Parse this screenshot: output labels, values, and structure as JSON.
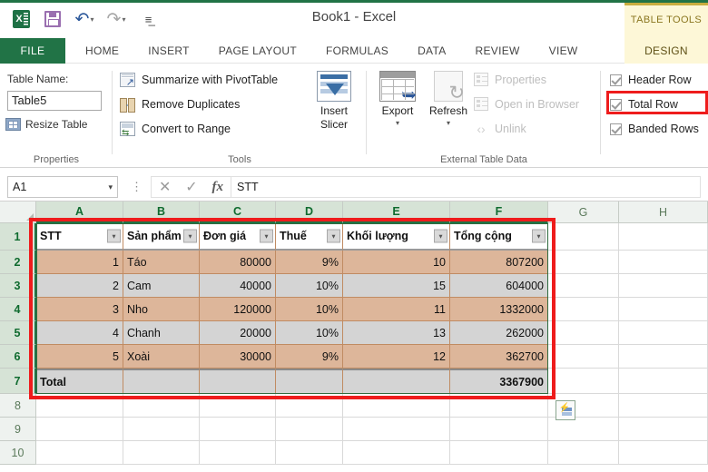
{
  "titlebar": {
    "app_title": "Book1 - Excel",
    "context_tab_group": "TABLE TOOLS",
    "qat": [
      {
        "name": "excel-logo-icon",
        "label": "X"
      },
      {
        "name": "save-icon",
        "label": "Save"
      },
      {
        "name": "undo-icon",
        "label": "Undo"
      },
      {
        "name": "redo-icon",
        "label": "Redo"
      },
      {
        "name": "customize-qat-icon",
        "label": "Customize Quick Access Toolbar"
      }
    ]
  },
  "ribbon_tabs": {
    "file": "FILE",
    "items": [
      "HOME",
      "INSERT",
      "PAGE LAYOUT",
      "FORMULAS",
      "DATA",
      "REVIEW",
      "VIEW"
    ],
    "design": "DESIGN",
    "active": "DESIGN"
  },
  "ribbon": {
    "properties": {
      "group_title": "Properties",
      "table_name_label": "Table Name:",
      "table_name_value": "Table5",
      "resize_table": "Resize Table"
    },
    "tools": {
      "group_title": "Tools",
      "summarize": "Summarize with PivotTable",
      "remove_duplicates": "Remove Duplicates",
      "convert_to_range": "Convert to Range",
      "insert_slicer_line1": "Insert",
      "insert_slicer_line2": "Slicer"
    },
    "external_data": {
      "group_title": "External Table Data",
      "export": "Export",
      "refresh": "Refresh",
      "properties": "Properties",
      "open_in_browser": "Open in Browser",
      "unlink": "Unlink",
      "dropdown_caret": "▾"
    },
    "style_options": {
      "header_row": {
        "label": "Header Row",
        "checked": true
      },
      "total_row": {
        "label": "Total Row",
        "checked": true,
        "highlighted": true
      },
      "banded_rows": {
        "label": "Banded Rows",
        "checked": true
      }
    }
  },
  "formula_bar": {
    "name_box_value": "A1",
    "name_box_caret": "▾",
    "cancel_icon": "✕",
    "enter_icon": "✓",
    "fx_icon": "fx",
    "formula_value": "STT"
  },
  "grid": {
    "column_headers": [
      "A",
      "B",
      "C",
      "D",
      "E",
      "F",
      "G",
      "H"
    ],
    "selected_columns": [
      "A",
      "B",
      "C",
      "D",
      "E",
      "F"
    ],
    "row_headers": [
      "1",
      "2",
      "3",
      "4",
      "5",
      "6",
      "7",
      "8",
      "9",
      "10"
    ],
    "selected_rows": [
      "1",
      "2",
      "3",
      "4",
      "5",
      "6",
      "7"
    ],
    "filter_caret": "▾"
  },
  "table": {
    "name": "Table5",
    "headers": [
      "STT",
      "Sản phẩm",
      "Đơn giá",
      "Thuế",
      "Khối lượng",
      "Tổng cộng"
    ],
    "rows": [
      [
        "1",
        "Táo",
        "80000",
        "9%",
        "10",
        "807200"
      ],
      [
        "2",
        "Cam",
        "40000",
        "10%",
        "15",
        "604000"
      ],
      [
        "3",
        "Nho",
        "120000",
        "10%",
        "11",
        "1332000"
      ],
      [
        "4",
        "Chanh",
        "20000",
        "10%",
        "13",
        "262000"
      ],
      [
        "5",
        "Xoài",
        "30000",
        "9%",
        "12",
        "362700"
      ]
    ],
    "total_row": [
      "Total",
      "",
      "",
      "",
      "",
      "3367900"
    ]
  },
  "colors": {
    "excel_green": "#217346",
    "context_yellow": "#fdf7d7",
    "highlight_red": "#ee1c1c",
    "band_a": "#ddb69a",
    "band_b": "#d4d4d4"
  }
}
